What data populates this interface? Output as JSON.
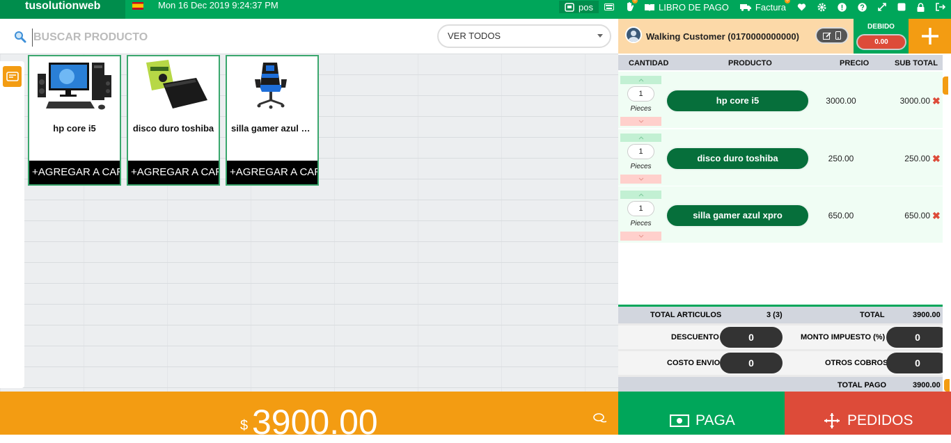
{
  "topbar": {
    "brand": "tusolutionweb",
    "datetime": "Mon 16 Dec 2019 9:24:37 PM",
    "pos_label": "pos",
    "book_label": "LIBRO DE PAGO",
    "invoice_label": "Factura",
    "hold_badge": "0",
    "invoice_badge": "0",
    "accent": "#00a65a"
  },
  "search": {
    "placeholder": "BUSCAR PRODUCTO",
    "filter_value": "VER TODOS"
  },
  "products": [
    {
      "name": "hp core i5",
      "add_label": "AGREGAR A CARRITO",
      "icon": "desktop-computer-image"
    },
    {
      "name": "disco duro toshiba",
      "add_label": "AGREGAR A CARRITO",
      "icon": "hard-drive-image"
    },
    {
      "name": "silla gamer azul xpro",
      "add_label": "AGREGAR A CARRITO",
      "icon": "gaming-chair-image"
    }
  ],
  "customer": {
    "name": "Walking Customer (0170000000000)",
    "debt_label": "DEBIDO",
    "debt_value": "0.00"
  },
  "cart": {
    "headers": {
      "qty": "CANTIDAD",
      "product": "PRODUCTO",
      "price": "PRECIO",
      "subtotal": "SUB TOTAL"
    },
    "items": [
      {
        "qty": "1",
        "unit": "Pieces",
        "product": "hp core i5",
        "price": "3000.00",
        "subtotal": "3000.00"
      },
      {
        "qty": "1",
        "unit": "Pieces",
        "product": "disco duro toshiba",
        "price": "250.00",
        "subtotal": "250.00"
      },
      {
        "qty": "1",
        "unit": "Pieces",
        "product": "silla gamer azul xpro",
        "price": "650.00",
        "subtotal": "650.00"
      }
    ]
  },
  "totals": {
    "items_label": "TOTAL ARTICULOS",
    "items_value": "3 (3)",
    "total_label": "TOTAL",
    "total_value": "3900.00",
    "discount_label": "DESCUENTO",
    "discount_value": "0",
    "tax_label": "MONTO IMPUESTO (%)",
    "tax_value": "0",
    "shipping_label": "COSTO ENVIO",
    "shipping_value": "0",
    "other_label": "OTROS COBROS",
    "other_value": "0",
    "pay_total_label": "TOTAL PAGO",
    "pay_total_value": "3900.00"
  },
  "bottom": {
    "currency": "$",
    "amount": "3900.00",
    "pay_label": "PAGA",
    "orders_label": "PEDIDOS"
  }
}
